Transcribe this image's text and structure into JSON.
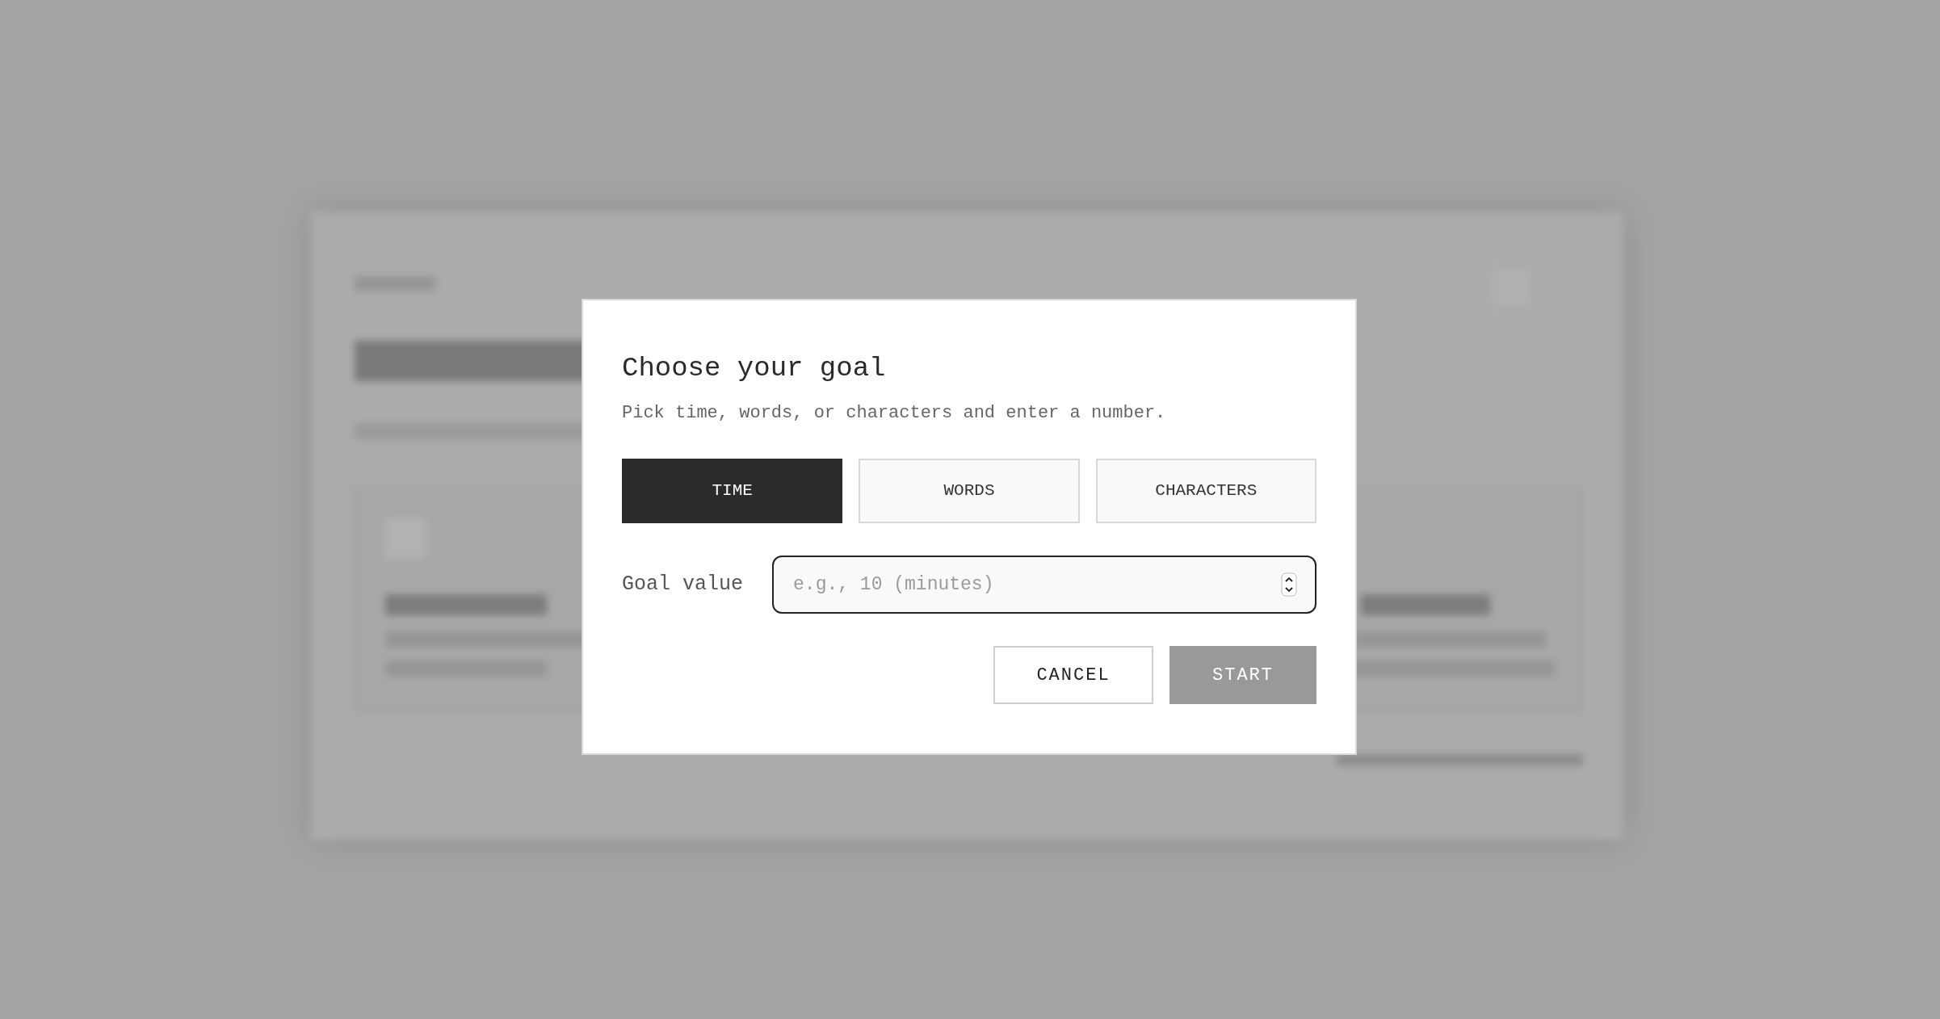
{
  "dialog": {
    "title": "Choose your goal",
    "subtitle": "Pick time, words, or characters and enter a number.",
    "goal_types": [
      {
        "label": "TIME",
        "selected": true
      },
      {
        "label": "WORDS",
        "selected": false
      },
      {
        "label": "CHARACTERS",
        "selected": false
      }
    ],
    "goal_value": {
      "label": "Goal value",
      "placeholder": "e.g., 10 (minutes)"
    },
    "buttons": [
      {
        "label": "CANCEL",
        "kind": "secondary",
        "disabled": false
      },
      {
        "label": "START",
        "kind": "primary",
        "disabled": true
      }
    ]
  }
}
